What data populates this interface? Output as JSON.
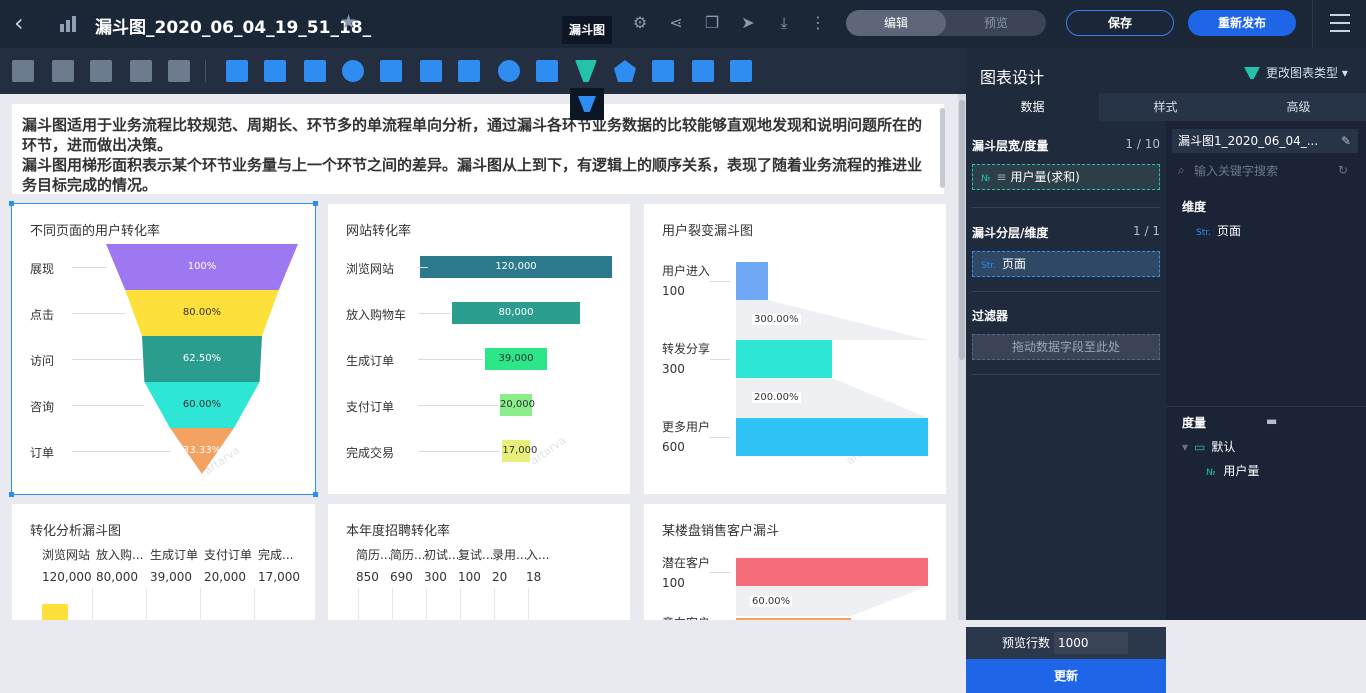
{
  "header": {
    "title": "漏斗图_2020_06_04_19_51_18_",
    "mode_edit": "编辑",
    "mode_preview": "预览",
    "save": "保存",
    "publish": "重新发布"
  },
  "toolbar": {
    "tooltip": "漏斗图"
  },
  "description": {
    "para1": "漏斗图适用于业务流程比较规范、周期长、环节多的单流程单向分析，通过漏斗各环节业务数据的比较能够直观地发现和说明问题所在的环节，进而做出决策。",
    "para2": "漏斗图用梯形面积表示某个环节业务量与上一个环节之间的差异。漏斗图从上到下，有逻辑上的顺序关系，表现了随着业务流程的推进业务目标完成的情况。"
  },
  "watermark": "artarva",
  "chart_data": [
    {
      "type": "funnel",
      "title": "不同页面的用户转化率",
      "categories": [
        "展现",
        "点击",
        "访问",
        "咨询",
        "订单"
      ],
      "values": [
        100,
        80,
        62.5,
        60,
        33.33
      ],
      "labels": [
        "100%",
        "80.00%",
        "62.50%",
        "60.00%",
        "33.33%"
      ],
      "colors": [
        "#9d78f0",
        "#fde03a",
        "#2a9d8f",
        "#2ee6d6",
        "#f4a261"
      ]
    },
    {
      "type": "funnel",
      "title": "网站转化率",
      "categories": [
        "浏览网站",
        "放入购物车",
        "生成订单",
        "支付订单",
        "完成交易"
      ],
      "values": [
        120000,
        80000,
        39000,
        20000,
        17000
      ],
      "labels": [
        "120,000",
        "80,000",
        "39,000",
        "20,000",
        "17,000"
      ],
      "colors": [
        "#2a7a8c",
        "#2a9d8f",
        "#2ee68a",
        "#8aef8a",
        "#e8ef7a"
      ]
    },
    {
      "type": "funnel",
      "title": "用户裂变漏斗图",
      "categories": [
        "用户进入",
        "转发分享",
        "更多用户"
      ],
      "values": [
        100,
        300,
        600
      ],
      "labels": [
        "300.00%",
        "200.00%"
      ],
      "colors": [
        "#6fa8f5",
        "#2ee6d6",
        "#2fc3f5"
      ]
    },
    {
      "type": "funnel",
      "title": "转化分析漏斗图",
      "categories": [
        "浏览网站",
        "放入购...",
        "生成订单",
        "支付订单",
        "完成..."
      ],
      "values": [
        120000,
        80000,
        39000,
        20000,
        17000
      ],
      "labels": [
        "120,000",
        "80,000",
        "39,000",
        "20,000",
        "17,000"
      ]
    },
    {
      "type": "funnel",
      "title": "本年度招聘转化率",
      "categories": [
        "简历...",
        "简历...",
        "初试...",
        "复试...",
        "录用...",
        "入..."
      ],
      "values": [
        850,
        690,
        300,
        100,
        20,
        18
      ],
      "labels": [
        "850",
        "690",
        "300",
        "100",
        "20",
        "18"
      ]
    },
    {
      "type": "funnel",
      "title": "某楼盘销售客户漏斗",
      "categories": [
        "潜在客户",
        "意向客户"
      ],
      "values": [
        100
      ],
      "labels": [
        "60.00%"
      ],
      "colors": [
        "#f46d7a",
        "#f4a261"
      ]
    }
  ],
  "panel": {
    "title": "图表设计",
    "change_type": "更改图表类型",
    "tabs": [
      "数据",
      "样式",
      "高级"
    ],
    "measure_section": "漏斗层宽/度量",
    "measure_count": "1 / 10",
    "measure_field": "用户量(求和)",
    "dim_section": "漏斗分层/维度",
    "dim_count": "1 / 1",
    "dim_field": "页面",
    "filter_section": "过滤器",
    "drop_hint": "拖动数据字段至此处",
    "dataset": "漏斗图1_2020_06_04_...",
    "search_placeholder": "输入关键字搜索",
    "dimension_title": "维度",
    "dimension_item": "页面",
    "measure_title": "度量",
    "folder": "默认",
    "measure_item": "用户量",
    "preview_label": "预览行数",
    "preview_value": "1000",
    "update": "更新"
  }
}
